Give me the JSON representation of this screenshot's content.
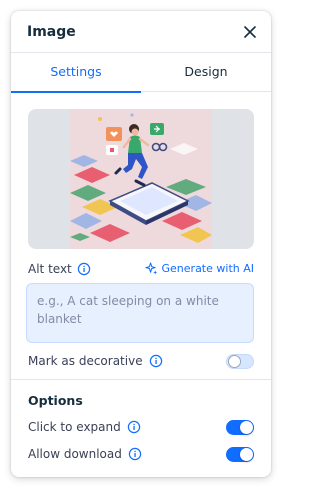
{
  "panel": {
    "title": "Image",
    "close_icon": "close-icon"
  },
  "tabs": [
    {
      "label": "Settings",
      "active": true
    },
    {
      "label": "Design",
      "active": false
    }
  ],
  "preview": {
    "description_icon": "image-preview"
  },
  "alt_text": {
    "label": "Alt text",
    "generate_label": "Generate with AI",
    "placeholder": "e.g., A cat sleeping on a white blanket",
    "value": ""
  },
  "decorative": {
    "label": "Mark as decorative",
    "enabled": false
  },
  "options": {
    "title": "Options",
    "click_to_expand": {
      "label": "Click to expand",
      "enabled": true
    },
    "allow_download": {
      "label": "Allow download",
      "enabled": true
    }
  },
  "colors": {
    "accent": "#116dff",
    "text": "#162d3d",
    "input_bg": "#e7f0ff"
  }
}
